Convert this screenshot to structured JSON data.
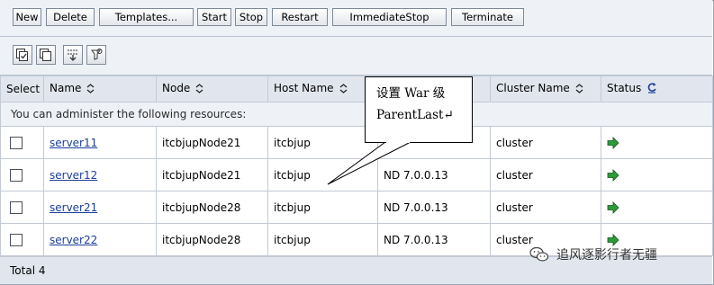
{
  "toolbar": {
    "new": "New",
    "delete": "Delete",
    "templates": "Templates...",
    "start": "Start",
    "stop": "Stop",
    "restart": "Restart",
    "immediate_stop": "ImmediateStop",
    "terminate": "Terminate"
  },
  "icon_buttons": [
    "select-all-icon",
    "deselect-all-icon",
    "expand-collapse-icon",
    "filter-icon"
  ],
  "columns": {
    "select": "Select",
    "name": "Name",
    "node": "Node",
    "host": "Host Name",
    "version": "",
    "cluster": "Cluster Name",
    "status": "Status"
  },
  "note": "You can administer the following resources:",
  "rows": [
    {
      "name": "server11",
      "node": "itcbjupNode21",
      "host": "itcbjup",
      "version": "",
      "cluster": "cluster",
      "status_icon": "started-arrow-icon"
    },
    {
      "name": "server12",
      "node": "itcbjupNode21",
      "host": "itcbjup",
      "version": "ND 7.0.0.13",
      "cluster": "cluster",
      "status_icon": "started-arrow-icon"
    },
    {
      "name": "server21",
      "node": "itcbjupNode28",
      "host": "itcbjup",
      "version": "ND 7.0.0.13",
      "cluster": "cluster",
      "status_icon": "started-arrow-icon"
    },
    {
      "name": "server22",
      "node": "itcbjupNode28",
      "host": "itcbjup",
      "version": "ND 7.0.0.13",
      "cluster": "cluster",
      "status_icon": "started-arrow-icon"
    }
  ],
  "total": "Total 4",
  "callout": {
    "line1": "设置 War 级",
    "line2": "ParentLast↵"
  },
  "watermark": "追风逐影行者无疆",
  "colors": {
    "link": "#1c3e9c",
    "status_green": "#2e9b3a",
    "header_bg": "#e1e6ee",
    "toolbar_bg": "#eef1f6"
  }
}
